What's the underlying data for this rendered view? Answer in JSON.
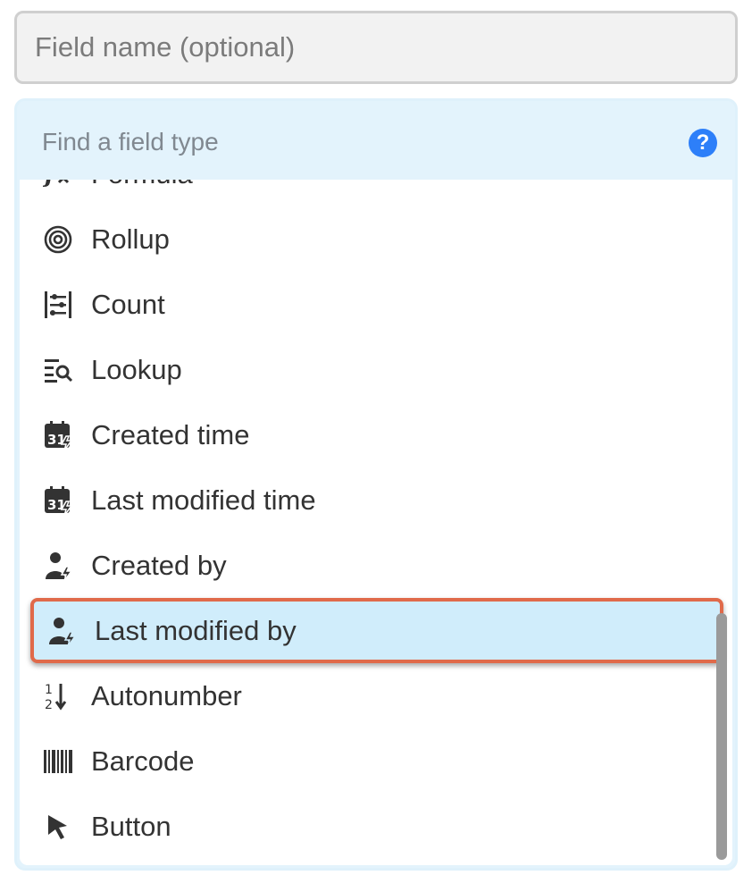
{
  "field_name": {
    "placeholder": "Field name (optional)"
  },
  "search": {
    "placeholder": "Find a field type",
    "help_label": "?"
  },
  "field_types": [
    {
      "label": "Formula",
      "icon": "formula-icon"
    },
    {
      "label": "Rollup",
      "icon": "rollup-icon"
    },
    {
      "label": "Count",
      "icon": "count-icon"
    },
    {
      "label": "Lookup",
      "icon": "lookup-icon"
    },
    {
      "label": "Created time",
      "icon": "calendar-bolt-icon"
    },
    {
      "label": "Last modified time",
      "icon": "calendar-bolt-icon"
    },
    {
      "label": "Created by",
      "icon": "user-bolt-icon"
    },
    {
      "label": "Last modified by",
      "icon": "user-bolt-icon",
      "selected": true
    },
    {
      "label": "Autonumber",
      "icon": "autonumber-icon"
    },
    {
      "label": "Barcode",
      "icon": "barcode-icon"
    },
    {
      "label": "Button",
      "icon": "cursor-icon"
    }
  ],
  "colors": {
    "accent": "#2d7ff9",
    "selection_bg": "#d0edfb",
    "highlight_border": "#e06a4a",
    "panel_bg": "#e3f3fc"
  }
}
